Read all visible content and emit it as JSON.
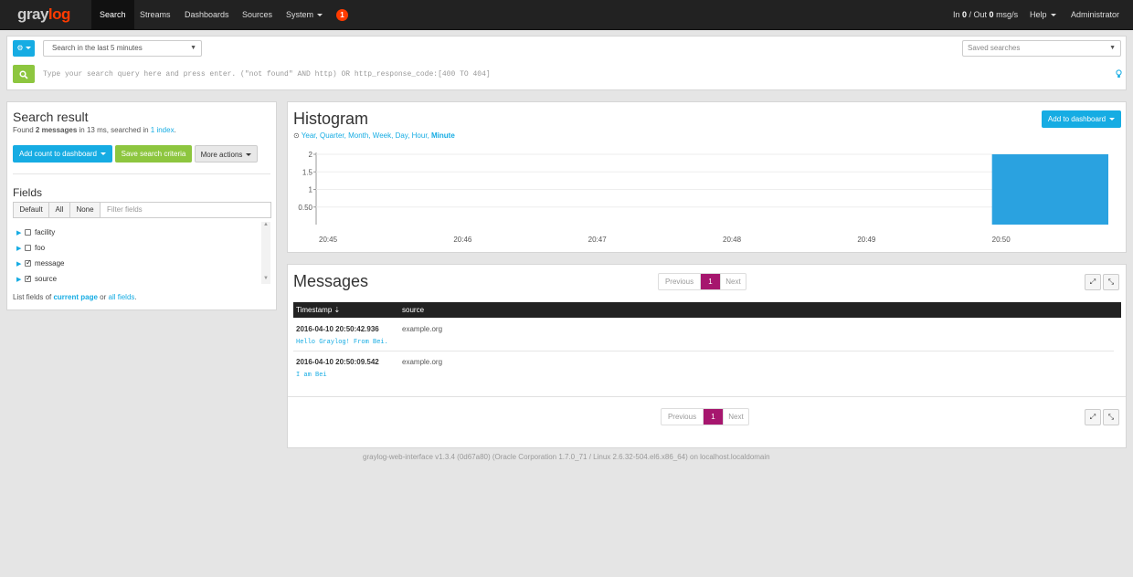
{
  "navbar": {
    "logo_text_left": "gray",
    "logo_text_right": "log",
    "items": [
      "Search",
      "Streams",
      "Dashboards",
      "Sources",
      "System"
    ],
    "notification_count": "1",
    "throughput_in_label": "In ",
    "throughput_in": "0",
    "throughput_sep": " / Out ",
    "throughput_out": "0",
    "throughput_unit": " msg/s",
    "help": "Help",
    "user": "Administrator"
  },
  "search": {
    "range": "Search in the last 5 minutes",
    "saved_searches": "Saved searches",
    "query_placeholder": "Type your search query here and press enter. (\"not found\" AND http) OR http_response_code:[400 TO 404]"
  },
  "result": {
    "title": "Search result",
    "found_prefix": "Found ",
    "found_count": "2 messages",
    "found_mid": " in 13 ms, searched in ",
    "found_index": "1 index",
    "found_suffix": ".",
    "add_count_button": "Add count to dashboard",
    "save_button": "Save search criteria",
    "more_button": "More actions"
  },
  "fields": {
    "title": "Fields",
    "tabs": [
      "Default",
      "All",
      "None"
    ],
    "filter_placeholder": "Filter fields",
    "items": [
      {
        "name": "facility",
        "checked": false
      },
      {
        "name": "foo",
        "checked": false
      },
      {
        "name": "message",
        "checked": true
      },
      {
        "name": "source",
        "checked": true
      }
    ],
    "list_prefix": "List fields of ",
    "list_current": "current page",
    "list_or": " or ",
    "list_all": "all fields",
    "list_suffix": "."
  },
  "histogram": {
    "title": "Histogram",
    "resolutions": [
      "Year",
      "Quarter",
      "Month",
      "Week",
      "Day",
      "Hour",
      "Minute"
    ],
    "current_resolution": "Minute",
    "add_button": "Add to dashboard",
    "bar_color": "#2aa2e0"
  },
  "chart_data": {
    "type": "bar",
    "categories": [
      "20:45",
      "20:46",
      "20:47",
      "20:48",
      "20:49",
      "20:50"
    ],
    "values": [
      0,
      0,
      0,
      0,
      0,
      2
    ],
    "yticks": [
      "0.50",
      "1",
      "1.5",
      "2"
    ],
    "ylim": [
      0,
      2
    ],
    "grid": true
  },
  "messages": {
    "title": "Messages",
    "pager_prev": "Previous",
    "pager_page": "1",
    "pager_next": "Next",
    "columns": [
      "Timestamp",
      "source"
    ],
    "rows": [
      {
        "timestamp": "2016-04-10 20:50:42.936",
        "source": "example.org",
        "message": "Hello Graylog! From Bei."
      },
      {
        "timestamp": "2016-04-10 20:50:09.542",
        "source": "example.org",
        "message": "I am Bei"
      }
    ]
  },
  "footer": "graylog-web-interface v1.3.4 (0d67a80) (Oracle Corporation 1.7.0_71 / Linux 2.6.32-504.el6.x86_64) on localhost.localdomain"
}
